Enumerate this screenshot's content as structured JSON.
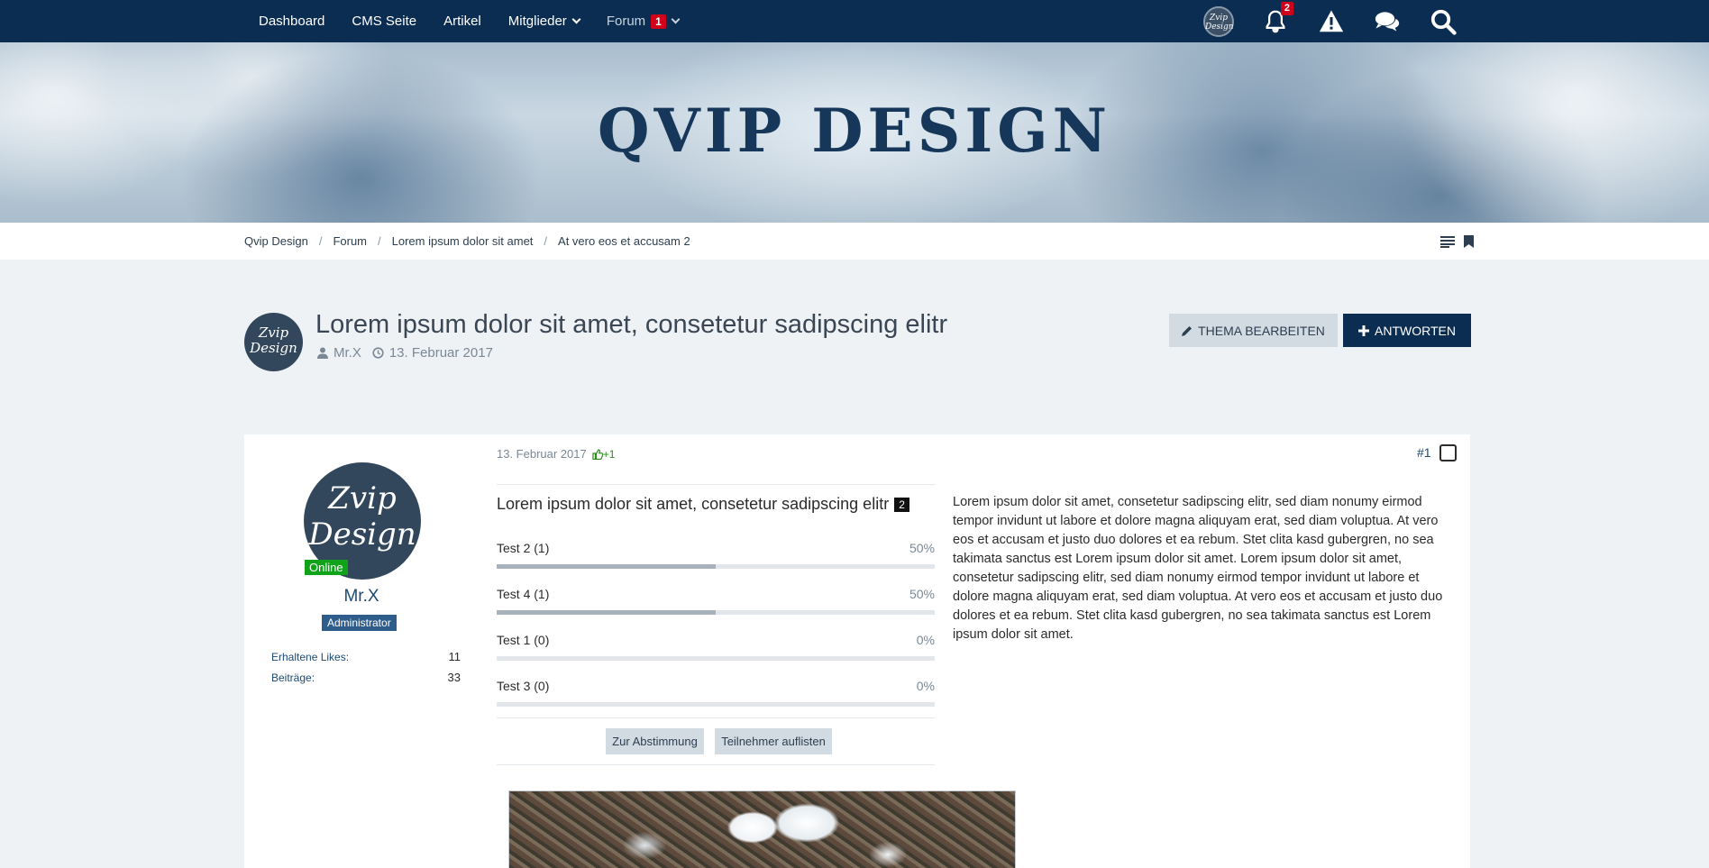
{
  "nav": {
    "items": [
      {
        "label": "Dashboard"
      },
      {
        "label": "CMS Seite"
      },
      {
        "label": "Artikel"
      },
      {
        "label": "Mitglieder"
      },
      {
        "label": "Forum",
        "badge": "1"
      }
    ],
    "avatar_text": "Zvip Design",
    "notifications_badge": "2",
    "icons": [
      "bell-icon",
      "warning-icon",
      "chat-icon",
      "search-icon"
    ]
  },
  "banner": {
    "title": "QVIP DESIGN"
  },
  "breadcrumb": {
    "items": [
      "Qvip Design",
      "Forum",
      "Lorem ipsum dolor sit amet",
      "At vero eos et accusam 2"
    ],
    "separator": "/"
  },
  "thread": {
    "title": "Lorem ipsum dolor sit amet, consetetur sadipscing elitr",
    "author": "Mr.X",
    "date": "13. Februar 2017",
    "avatar_text": "Zvip Design",
    "edit_label": "THEMA BEARBEITEN",
    "reply_label": "ANTWORTEN"
  },
  "user": {
    "avatar_text": "Zvip Design",
    "status": "Online",
    "name": "Mr.X",
    "rank": "Administrator",
    "stats": [
      {
        "label": "Erhaltene Likes:",
        "value": "11"
      },
      {
        "label": "Beiträge:",
        "value": "33"
      }
    ]
  },
  "post": {
    "date": "13. Februar 2017",
    "likes": "+1",
    "number": "#1",
    "text": "Lorem ipsum dolor sit amet, consetetur sadipscing elitr, sed diam nonumy eirmod tempor invidunt ut labore et dolore magna aliquyam erat, sed diam voluptua. At vero eos et accusam et justo duo dolores et ea rebum. Stet clita kasd gubergren, no sea takimata sanctus est Lorem ipsum dolor sit amet. Lorem ipsum dolor sit amet, consetetur sadipscing elitr, sed diam nonumy eirmod tempor invidunt ut labore et dolore magna aliquyam erat, sed diam voluptua. At vero eos et accusam et justo duo dolores et ea rebum. Stet clita kasd gubergren, no sea takimata sanctus est Lorem ipsum dolor sit amet."
  },
  "poll": {
    "title": "Lorem ipsum dolor sit amet, consetetur sadipscing elitr",
    "count": "2",
    "options": [
      {
        "label": "Test 2 (1)",
        "percent": "50%",
        "fraction": 0.5
      },
      {
        "label": "Test 4 (1)",
        "percent": "50%",
        "fraction": 0.5
      },
      {
        "label": "Test 1 (0)",
        "percent": "0%",
        "fraction": 0
      },
      {
        "label": "Test 3 (0)",
        "percent": "0%",
        "fraction": 0
      }
    ],
    "vote_button": "Zur Abstimmung",
    "participants_button": "Teilnehmer auflisten"
  },
  "colors": {
    "nav_bg": "#0c2d52",
    "accent": "#0c2d52",
    "badge": "#d0021b",
    "online": "#10a31a",
    "like": "#2a8c1a"
  }
}
